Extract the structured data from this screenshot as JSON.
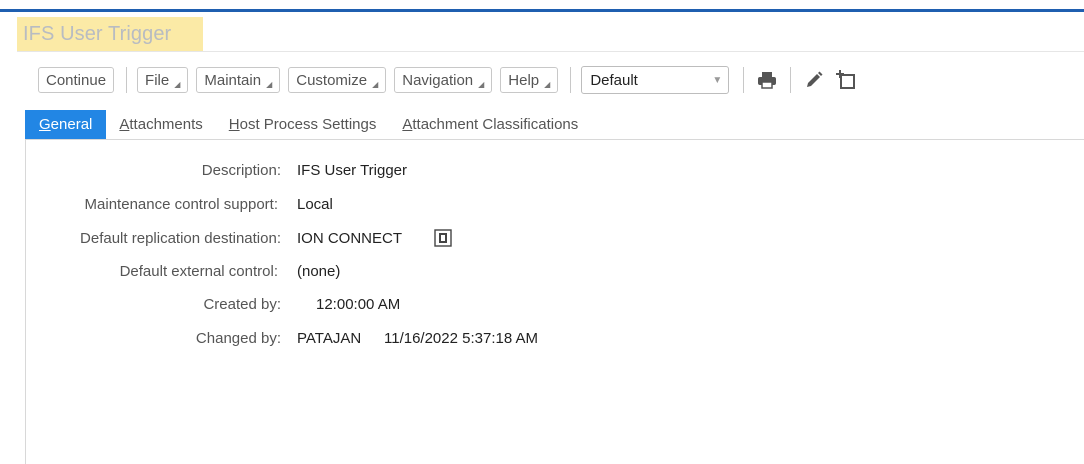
{
  "header": {
    "title": "IFS User Trigger"
  },
  "toolbar": {
    "continue_label": "Continue",
    "menus": [
      "File",
      "Maintain",
      "Customize",
      "Navigation",
      "Help"
    ],
    "view_select": "Default",
    "icons": [
      "printer-icon",
      "pencil-icon",
      "new-record-icon"
    ]
  },
  "tabs": [
    {
      "underline": "G",
      "rest": "eneral",
      "active": true
    },
    {
      "underline": "A",
      "rest": "ttachments",
      "active": false
    },
    {
      "underline": "H",
      "rest": "ost Process Settings",
      "active": false
    },
    {
      "underline": "A",
      "rest": "ttachment Classifications",
      "active": false
    }
  ],
  "form": {
    "description_label": "Description:",
    "description_value": "IFS User Trigger",
    "maintenance_label": "Maintenance control support:",
    "maintenance_value": "Local",
    "replication_label": "Default replication destination:",
    "replication_value": "ION CONNECT",
    "external_label": "Default external control:",
    "external_value": "(none)",
    "created_label": "Created by:",
    "created_value": "12:00:00 AM",
    "changed_label": "Changed by:",
    "changed_user": "PATAJAN",
    "changed_time": "11/16/2022 5:37:18 AM"
  }
}
